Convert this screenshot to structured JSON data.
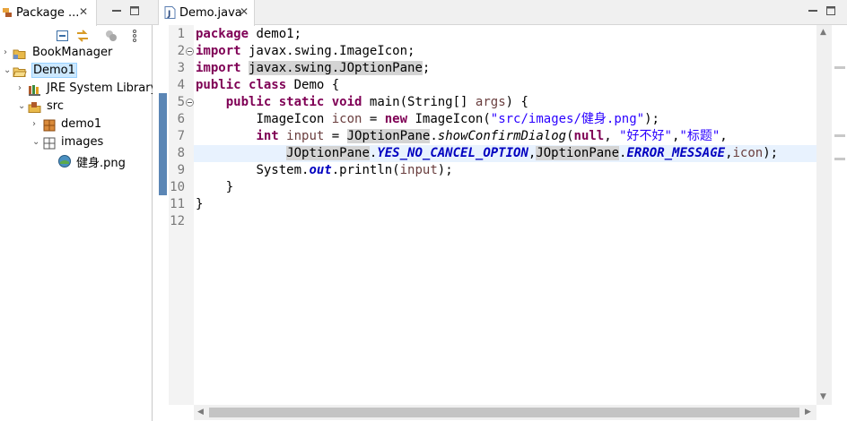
{
  "explorer": {
    "tab_label": "Package ...",
    "tab_close": "✕",
    "tree": [
      {
        "label": "BookManager",
        "icon": "project-folder-icon",
        "expanded": false
      },
      {
        "label": "Demo1",
        "icon": "open-project-folder-icon",
        "expanded": true,
        "selected": true
      },
      {
        "label": "JRE System Library",
        "icon": "library-icon",
        "expanded": false
      },
      {
        "label": "src",
        "icon": "source-folder-icon",
        "expanded": true
      },
      {
        "label": "demo1",
        "icon": "package-icon",
        "expanded": false
      },
      {
        "label": "images",
        "icon": "package-icon",
        "expanded": true
      },
      {
        "label": "健身.png",
        "icon": "image-file-icon"
      }
    ]
  },
  "editor": {
    "tab_label": "Demo.java",
    "tab_close": "✕",
    "line_numbers": [
      "1",
      "2",
      "3",
      "4",
      "5",
      "6",
      "7",
      "8",
      "9",
      "10",
      "11",
      "12"
    ],
    "code": {
      "l1_kw": "package",
      "l1_rest": " demo1;",
      "l2_kw": "import",
      "l2_rest": " javax.swing.ImageIcon;",
      "l3_kw": "import",
      "l3_occ": "javax.swing.JOptionPane",
      "l3_end": ";",
      "l4_kw1": "public",
      "l4_kw2": "class",
      "l4_rest": " Demo {",
      "l5_indent": "    ",
      "l5_kw1": "public",
      "l5_kw2": "static",
      "l5_kw3": "void",
      "l5_main": " main(String[] ",
      "l5_args": "args",
      "l5_end": ") {",
      "l6_indent": "        ",
      "l6_type": "ImageIcon ",
      "l6_var": "icon",
      "l6_eq": " = ",
      "l6_new": "new",
      "l6_ctor": " ImageIcon(",
      "l6_str": "\"src/images/健身.png\"",
      "l6_end": ");",
      "l7_indent": "        ",
      "l7_int": "int",
      "l7_sp": " ",
      "l7_var": "input",
      "l7_eq": " = ",
      "l7_occ": "JOptionPane",
      "l7_dot": ".",
      "l7_method": "showConfirmDialog",
      "l7_paren": "(",
      "l7_null": "null",
      "l7_comma": ", ",
      "l7_str1": "\"好不好\"",
      "l7_comma2": ",",
      "l7_str2": "\"标题\"",
      "l7_end": ",",
      "l8_indent": "            ",
      "l8_occ1": "JOptionPane",
      "l8_dot1": ".",
      "l8_const1": "YES_NO_CANCEL_OPTION",
      "l8_comma": ",",
      "l8_occ2": "JOptionPane",
      "l8_dot2": ".",
      "l8_const2": "ERROR_MESSAGE",
      "l8_comma2": ",",
      "l8_icon": "icon",
      "l8_end": ");",
      "l9_indent": "        ",
      "l9_sys": "System.",
      "l9_out": "out",
      "l9_print": ".println(",
      "l9_var": "input",
      "l9_end": ");",
      "l10": "    }",
      "l11": "}"
    }
  },
  "colors": {
    "keyword": "#7f0055",
    "string": "#2a00ff",
    "local_variable": "#6a3e3e",
    "static_field": "#0000c0",
    "current_line": "#e8f2fe",
    "occurrence": "#d4d4d4",
    "selection": "#cce8ff"
  }
}
